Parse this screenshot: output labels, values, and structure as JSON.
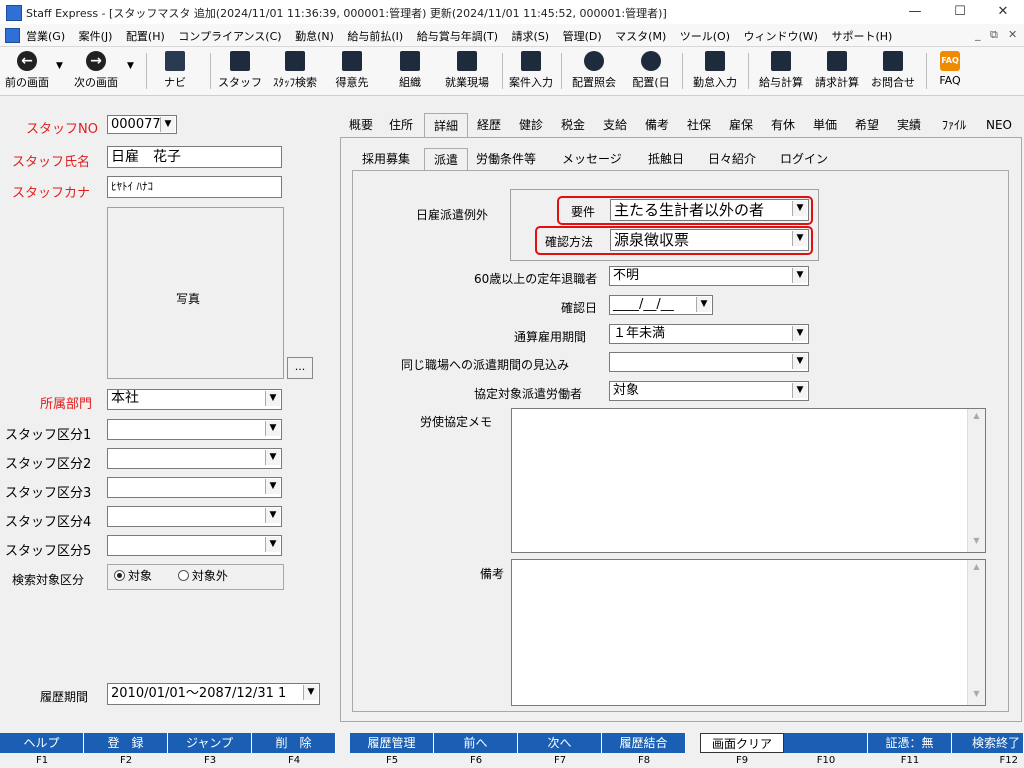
{
  "window": {
    "title": "Staff Express - [スタッフマスタ 追加(2024/11/01 11:36:39, 000001:管理者) 更新(2024/11/01 11:45:52, 000001:管理者)]",
    "minimize": "—",
    "maximize": "☐",
    "close": "✕"
  },
  "menu": {
    "items": [
      "営業(G)",
      "案件(J)",
      "配置(H)",
      "コンプライアンス(C)",
      "勤怠(N)",
      "給与前払(I)",
      "給与賞与年調(T)",
      "請求(S)",
      "管理(D)",
      "マスタ(M)",
      "ツール(O)",
      "ウィンドウ(W)",
      "サポート(H)"
    ],
    "mdi_min": "_",
    "mdi_restore": "⧉",
    "mdi_close": "✕"
  },
  "toolbar": {
    "back": "前の画面",
    "next": "次の画面",
    "navi": "ナビ",
    "staff": "スタッフ",
    "staff_search": "ｽﾀｯﾌ検索",
    "client": "得意先",
    "org": "組織",
    "worksite": "就業現場",
    "job_entry": "案件入力",
    "placement_inquiry": "配置照会",
    "placement_day": "配置(日",
    "attendance": "勤怠入力",
    "payroll": "給与計算",
    "billing": "請求計算",
    "contact": "お問合せ",
    "faq": "FAQ",
    "faq_icon_text": "FAQ"
  },
  "left": {
    "staff_no_label": "スタッフNO",
    "staff_no_value": "000077",
    "staff_name_label": "スタッフ氏名",
    "staff_name_value": "日雇　花子",
    "staff_kana_label": "スタッフカナ",
    "staff_kana_value": "ﾋﾔﾄｲ ﾊﾅｺ",
    "photo_label": "写真",
    "photo_button": "...",
    "dept_label": "所属部門",
    "dept_value": "本社",
    "class1_label": "スタッフ区分1",
    "class2_label": "スタッフ区分2",
    "class3_label": "スタッフ区分3",
    "class4_label": "スタッフ区分4",
    "class5_label": "スタッフ区分5",
    "search_label": "検索対象区分",
    "radio_target": "対象",
    "radio_exclude": "対象外",
    "history_label": "履歴期間",
    "history_value": "2010/01/01～2087/12/31 1"
  },
  "tabs_main": [
    "概要",
    "住所",
    "詳細",
    "経歴",
    "健診",
    "税金",
    "支給",
    "備考",
    "社保",
    "雇保",
    "有休",
    "単価",
    "希望",
    "実績",
    "ﾌｧｲﾙ",
    "NEO"
  ],
  "tabs_sub": [
    "採用募集",
    "派遣",
    "労働条件等",
    "メッセージ",
    "抵触日",
    "日々紹介",
    "ログイン"
  ],
  "dispatch": {
    "exception_label": "日雇派遣例外",
    "requirement_label": "要件",
    "requirement_value": "主たる生計者以外の者",
    "confirm_method_label": "確認方法",
    "confirm_method_value": "源泉徴収票",
    "retired60_label": "60歳以上の定年退職者",
    "retired60_value": "不明",
    "confirm_date_label": "確認日",
    "confirm_date_value": "____/__/__",
    "employment_period_label": "通算雇用期間",
    "employment_period_value": "１年未満",
    "same_workplace_label": "同じ職場への派遣期間の見込み",
    "same_workplace_value": "",
    "agreement_worker_label": "協定対象派遣労働者",
    "agreement_worker_value": "対象",
    "labor_memo_label": "労使協定メモ",
    "remarks_label": "備考"
  },
  "fkeys": [
    {
      "label": "ヘルプ",
      "key": "F1"
    },
    {
      "label": "登　録",
      "key": "F2"
    },
    {
      "label": "ジャンプ",
      "key": "F3"
    },
    {
      "label": "削　除",
      "key": "F4"
    },
    {
      "label": "履歴管理",
      "key": "F5"
    },
    {
      "label": "前へ",
      "key": "F6"
    },
    {
      "label": "次へ",
      "key": "F7"
    },
    {
      "label": "履歴結合",
      "key": "F8"
    },
    {
      "label": "画面クリア",
      "key": "F9"
    },
    {
      "label": "",
      "key": "F10"
    },
    {
      "label": "証憑：無",
      "key": "F11"
    },
    {
      "label": "検索終了",
      "key": "F12"
    }
  ],
  "colors": {
    "required_label": "#e01e1e",
    "highlight": "#e01010",
    "fkey_bg": "#1a5fb4"
  }
}
